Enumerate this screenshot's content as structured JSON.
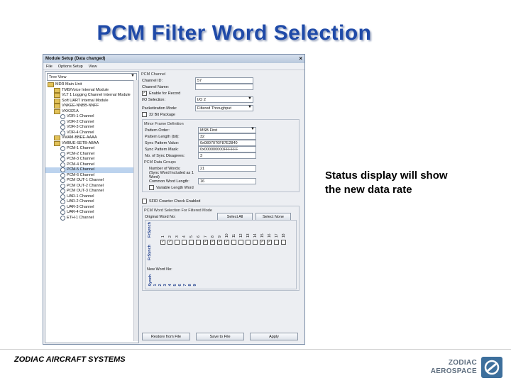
{
  "slide": {
    "title": "PCM Filter Word Selection",
    "caption_line1": "Status display will show",
    "caption_line2": "the new data rate",
    "footer": "ZODIAC AIRCRAFT SYSTEMS",
    "logo_line1": "ZODIAC",
    "logo_line2": "AEROSPACE"
  },
  "window": {
    "title": "Module Setup (Data changed)",
    "close": "×",
    "menu": [
      "File",
      "Options Setup",
      "View"
    ]
  },
  "tree": {
    "view_label": "Tree View",
    "items": [
      {
        "label": "MDR Main Unit",
        "type": "folder",
        "indent": 0
      },
      {
        "label": "TMB/Voice Internal Module",
        "type": "folder",
        "indent": 1
      },
      {
        "label": "VLT 1 Logging Channel Internal Module",
        "type": "folder",
        "indent": 1
      },
      {
        "label": "Soft UART Internal Module",
        "type": "folder",
        "indent": 1
      },
      {
        "label": "VNKEE-NNBB-NNFF",
        "type": "folder",
        "indent": 1
      },
      {
        "label": "VKK321A",
        "type": "folder",
        "indent": 1
      },
      {
        "label": "VDR-1 Channel",
        "type": "channel",
        "indent": 2
      },
      {
        "label": "VDR-2 Channel",
        "type": "channel",
        "indent": 2
      },
      {
        "label": "VDR-3 Channel",
        "type": "channel",
        "indent": 2
      },
      {
        "label": "VDR-4 Channel",
        "type": "channel",
        "indent": 2
      },
      {
        "label": "VMAM-BBEE-AAAA",
        "type": "folder",
        "indent": 1
      },
      {
        "label": "VMBUE-SETB-ABAA",
        "type": "folder",
        "indent": 1
      },
      {
        "label": "PCM-1 Channel",
        "type": "channel",
        "indent": 2
      },
      {
        "label": "PCM-2 Channel",
        "type": "channel",
        "indent": 2
      },
      {
        "label": "PCM-3 Channel",
        "type": "channel",
        "indent": 2
      },
      {
        "label": "PCM-4 Channel",
        "type": "channel",
        "indent": 2
      },
      {
        "label": "PCM-5 Channel",
        "type": "channel",
        "indent": 2,
        "selected": true
      },
      {
        "label": "PCM-6 Channel",
        "type": "channel",
        "indent": 2
      },
      {
        "label": "PCM OUT-1 Channel",
        "type": "channel",
        "indent": 2
      },
      {
        "label": "PCM OUT-2 Channel",
        "type": "channel",
        "indent": 2
      },
      {
        "label": "PCM OUT-3 Channel",
        "type": "channel",
        "indent": 2
      },
      {
        "label": "UAR-1 Channel",
        "type": "channel",
        "indent": 2
      },
      {
        "label": "UAR-2 Channel",
        "type": "channel",
        "indent": 2
      },
      {
        "label": "UAR-3 Channel",
        "type": "channel",
        "indent": 2
      },
      {
        "label": "UAR-4 Channel",
        "type": "channel",
        "indent": 2
      },
      {
        "label": "ETH-1 Channel",
        "type": "channel",
        "indent": 2
      }
    ]
  },
  "form": {
    "section_title": "PCM Channel",
    "channel_id_label": "Channel ID:",
    "channel_id_value": "57",
    "channel_name_label": "Channel Name:",
    "channel_name_value": "",
    "enable_record_label": "Enable for Record",
    "io_selection_label": "I/O Selection:",
    "io_selection_value": "I/O 2",
    "packetization_label": "Packetization Mode:",
    "packetization_value": "Filtered Throughput",
    "bit32_label": "32 Bit Package",
    "minor_frame_title": "Minor Frame Definition",
    "pattern_order_label": "Pattern Order:",
    "pattern_order_value": "MSB First",
    "pattern_length_label": "Pattern Length (bit):",
    "pattern_length_value": "32",
    "sync_pattern_value_label": "Sync Pattern Value:",
    "sync_pattern_value": "0x0807070F87E2840",
    "sync_pattern_mask_label": "Sync Pattern Mask:",
    "sync_pattern_mask": "0x000000000FFFFFF",
    "sync_disagrees_label": "No. of Sync Disagrees:",
    "sync_disagrees_value": "3",
    "data_groups_title": "PCM Data Groups",
    "num_words_label": "Number of Words:",
    "num_words_value": "21",
    "sync_word_note": "(Sync Word Included as 1 Word)",
    "common_word_len_label": "Common Word Length:",
    "common_word_len_value": "16",
    "variable_length_label": "Variable Length Word",
    "sfid_label": "SFID Counter Check Enabled",
    "filtered_mode_title": "PCM Word Selection For Filtered Mode",
    "original_word_label": "Original Word No:",
    "select_all": "Select All",
    "select_none": "Select None",
    "side_top": "FrSynch",
    "side_bottom": "FrSynch",
    "new_word_label": "New Word No:",
    "sync_label": "Synch"
  },
  "word_columns": [
    "1",
    "2",
    "3",
    "4",
    "5",
    "6",
    "7",
    "8",
    "9",
    "10",
    "11",
    "12",
    "13",
    "14",
    "15",
    "16",
    "17",
    "18"
  ],
  "word_checked": [
    true,
    true,
    false,
    false,
    false,
    false,
    true,
    true,
    true,
    true,
    false,
    false,
    false,
    false,
    true,
    true,
    false,
    false
  ],
  "new_word_numbers": [
    "1",
    "2",
    "3",
    "4",
    "5",
    "6",
    "7",
    "8",
    "9"
  ],
  "bottom_buttons": {
    "restore": "Restore from File",
    "save": "Save to File",
    "apply": "Apply"
  }
}
